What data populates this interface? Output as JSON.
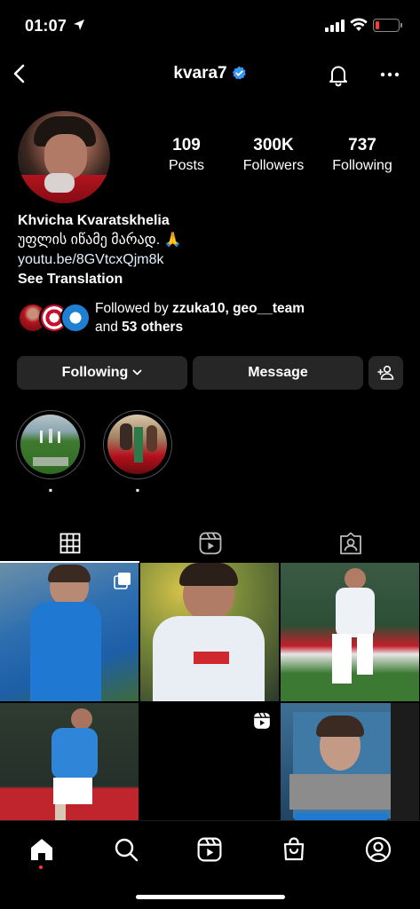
{
  "status_bar": {
    "time": "01:07"
  },
  "header": {
    "username": "kvara7"
  },
  "profile": {
    "stats": [
      {
        "value": "109",
        "label": "Posts"
      },
      {
        "value": "300K",
        "label": "Followers"
      },
      {
        "value": "737",
        "label": "Following"
      }
    ],
    "name": "Khvicha Kvaratskhelia",
    "bio": "უფლის იწამე მარად. 🙏",
    "link": "youtu.be/8GVtcxQjm8k",
    "see_translation": "See Translation",
    "followed_by": {
      "prefix": "Followed by ",
      "names": "zzuka10, geo__team",
      "and": "and ",
      "others": "53 others"
    }
  },
  "actions": {
    "following_label": "Following",
    "message_label": "Message"
  },
  "highlights": [
    {
      "label": "▪"
    },
    {
      "label": "▪"
    }
  ],
  "tabs": [
    "grid-icon",
    "reels-icon",
    "tagged-icon"
  ],
  "grid_posts": [
    {
      "type": "carousel"
    },
    {
      "type": "photo"
    },
    {
      "type": "photo"
    },
    {
      "type": "photo"
    },
    {
      "type": "reel"
    },
    {
      "type": "photo"
    }
  ],
  "bottom_nav": [
    "home-icon",
    "search-icon",
    "reels-icon",
    "shop-icon",
    "profile-icon"
  ],
  "colors": {
    "background": "#000000",
    "button_bg": "#262626",
    "verified": "#3897f0",
    "link": "#e0f1ff",
    "battery_low": "#ff3b30",
    "notification_dot": "#ff2e55"
  }
}
